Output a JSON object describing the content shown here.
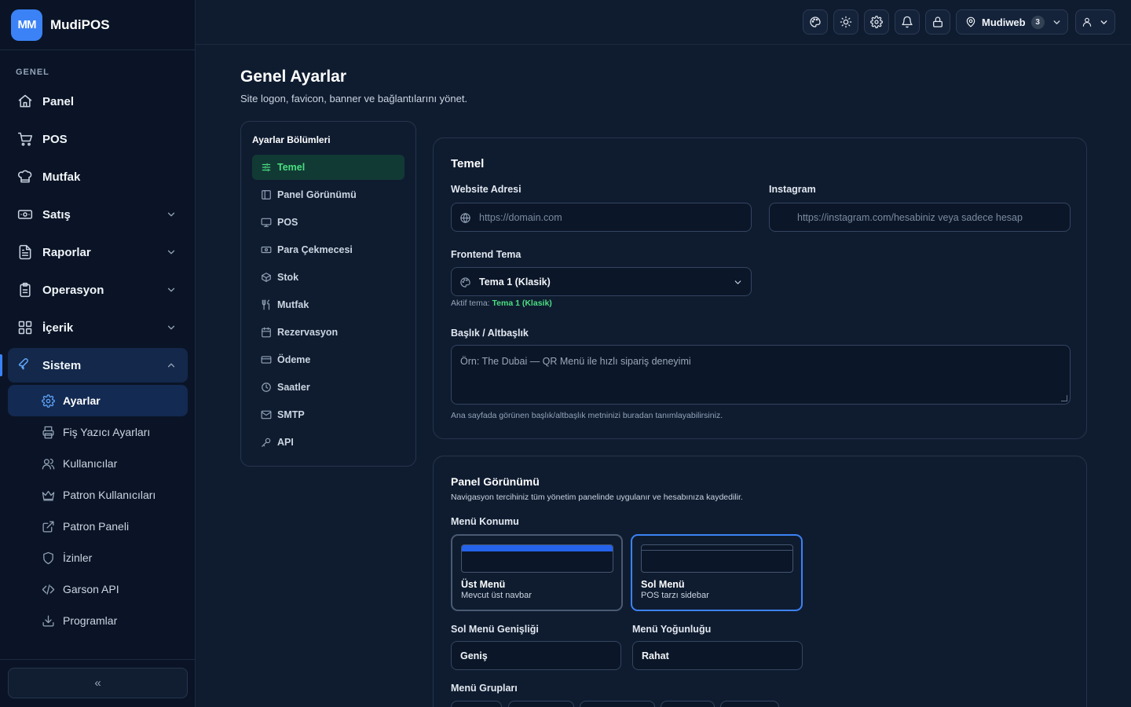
{
  "brand": {
    "logo": "MM",
    "name": "MudiPOS"
  },
  "sidebar": {
    "section": "GENEL",
    "items": [
      {
        "label": "Panel",
        "icon": "home-icon"
      },
      {
        "label": "POS",
        "icon": "cart-icon"
      },
      {
        "label": "Mutfak",
        "icon": "chef-hat-icon"
      },
      {
        "label": "Satış",
        "icon": "banknote-icon"
      },
      {
        "label": "Raporlar",
        "icon": "file-text-icon"
      },
      {
        "label": "Operasyon",
        "icon": "clipboard-icon"
      },
      {
        "label": "İçerik",
        "icon": "grid-icon"
      },
      {
        "label": "Sistem",
        "icon": "wrench-icon"
      }
    ],
    "sub_items": [
      {
        "label": "Ayarlar",
        "icon": "gear-icon"
      },
      {
        "label": "Fiş Yazıcı Ayarları",
        "icon": "printer-icon"
      },
      {
        "label": "Kullanıcılar",
        "icon": "users-icon"
      },
      {
        "label": "Patron Kullanıcıları",
        "icon": "crown-icon"
      },
      {
        "label": "Patron Paneli",
        "icon": "external-link-icon"
      },
      {
        "label": "İzinler",
        "icon": "shield-icon"
      },
      {
        "label": "Garson API",
        "icon": "code-icon"
      },
      {
        "label": "Programlar",
        "icon": "download-icon"
      }
    ],
    "collapse": "«"
  },
  "topbar": {
    "location": "Mudiweb",
    "location_count": "3"
  },
  "page": {
    "title": "Genel Ayarlar",
    "subtitle": "Site logon, favicon, banner ve bağlantılarını yönet."
  },
  "sections": {
    "title": "Ayarlar Bölümleri",
    "items": [
      {
        "label": "Temel"
      },
      {
        "label": "Panel Görünümü"
      },
      {
        "label": "POS"
      },
      {
        "label": "Para Çekmecesi"
      },
      {
        "label": "Stok"
      },
      {
        "label": "Mutfak"
      },
      {
        "label": "Rezervasyon"
      },
      {
        "label": "Ödeme"
      },
      {
        "label": "Saatler"
      },
      {
        "label": "SMTP"
      },
      {
        "label": "API"
      }
    ]
  },
  "temel": {
    "title": "Temel",
    "website_label": "Website Adresi",
    "website_placeholder": "https://domain.com",
    "instagram_label": "Instagram",
    "instagram_placeholder": "https://instagram.com/hesabiniz veya sadece hesap",
    "theme_label": "Frontend Tema",
    "theme_value": "Tema 1 (Klasik)",
    "active_theme_prefix": "Aktif tema:",
    "active_theme_value": "Tema 1 (Klasik)",
    "heading_label": "Başlık / Altbaşlık",
    "heading_placeholder": "Örn: The Dubai — QR Menü ile hızlı sipariş deneyimi",
    "heading_hint": "Ana sayfada görünen başlık/altbaşlık metninizi buradan tanımlayabilirsiniz."
  },
  "panel_view": {
    "title": "Panel Görünümü",
    "description": "Navigasyon tercihiniz tüm yönetim panelinde uygulanır ve hesabınıza kaydedilir.",
    "menu_position_label": "Menü Konumu",
    "options": [
      {
        "title": "Üst Menü",
        "subtitle": "Mevcut üst navbar"
      },
      {
        "title": "Sol Menü",
        "subtitle": "POS tarzı sidebar"
      }
    ],
    "selected_option": "Sol Menü",
    "width_label": "Sol Menü Genişliği",
    "width_value": "Geniş",
    "density_label": "Menü Yoğunluğu",
    "density_value": "Rahat",
    "groups_label": "Menü Grupları"
  },
  "colors": {
    "accent": "#3b82f6",
    "active_section": "#4ade80"
  }
}
